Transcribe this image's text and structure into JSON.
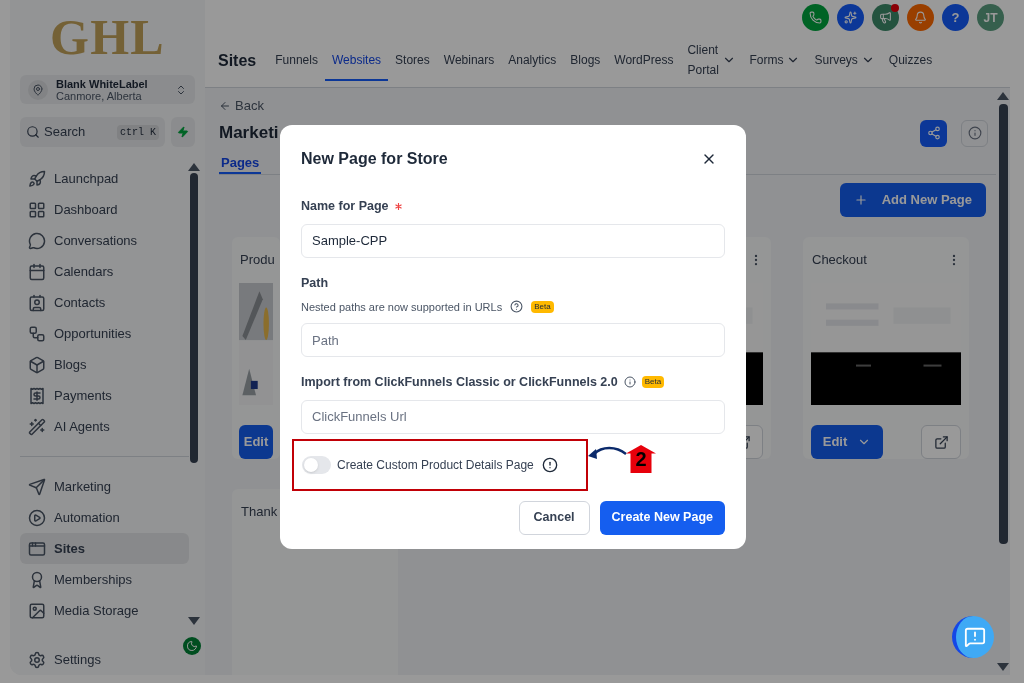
{
  "logo": "GHL",
  "account": {
    "name": "Blank WhiteLabel",
    "location": "Canmore, Alberta"
  },
  "search": {
    "placeholder": "Search",
    "shortcut": "ctrl K"
  },
  "sidebar": {
    "groups": [
      {
        "items": [
          {
            "label": "Launchpad",
            "selected": false
          },
          {
            "label": "Dashboard",
            "selected": false
          },
          {
            "label": "Conversations",
            "selected": false
          },
          {
            "label": "Calendars",
            "selected": false
          },
          {
            "label": "Contacts",
            "selected": false
          },
          {
            "label": "Opportunities",
            "selected": false
          },
          {
            "label": "Blogs",
            "selected": false
          },
          {
            "label": "Payments",
            "selected": false
          },
          {
            "label": "AI Agents",
            "selected": false
          }
        ]
      },
      {
        "items": [
          {
            "label": "Marketing",
            "selected": false
          },
          {
            "label": "Automation",
            "selected": false
          },
          {
            "label": "Sites",
            "selected": true
          },
          {
            "label": "Memberships",
            "selected": false
          },
          {
            "label": "Media Storage",
            "selected": false
          }
        ]
      }
    ],
    "settings": "Settings"
  },
  "header": {
    "title": "Sites",
    "tabs": [
      {
        "label": "Funnels",
        "selected": false,
        "menu": false
      },
      {
        "label": "Websites",
        "selected": true,
        "menu": false
      },
      {
        "label": "Stores",
        "selected": false,
        "menu": false
      },
      {
        "label": "Webinars",
        "selected": false,
        "menu": false
      },
      {
        "label": "Analytics",
        "selected": false,
        "menu": false
      },
      {
        "label": "Blogs",
        "selected": false,
        "menu": false
      },
      {
        "label": "WordPress",
        "selected": false,
        "menu": false
      },
      {
        "label": "Client Portal",
        "selected": false,
        "menu": true
      },
      {
        "label": "Forms",
        "selected": false,
        "menu": true
      },
      {
        "label": "Surveys",
        "selected": false,
        "menu": true
      },
      {
        "label": "Quizzes",
        "selected": false,
        "menu": false
      }
    ],
    "avatar": "JT",
    "help": "?"
  },
  "page": {
    "back": "Back",
    "title": "Marketi",
    "tabs": [
      {
        "label": "Pages",
        "selected": true
      }
    ],
    "add_button": "Add New Page",
    "cards": [
      {
        "title": "Produ",
        "edit": "Edit"
      },
      {
        "title": "Checkout",
        "edit": "Edit"
      },
      {
        "title": "Thank"
      }
    ]
  },
  "modal": {
    "title": "New Page for Store",
    "fields": [
      {
        "label": "Name for Page",
        "required": true,
        "value": "Sample-CPP"
      },
      {
        "label": "Path",
        "hint": "Nested paths are now supported in URLs",
        "badge": "Beta",
        "placeholder": "Path"
      },
      {
        "label": "Import from ClickFunnels Classic or ClickFunnels 2.0",
        "badge": "Beta",
        "placeholder": "ClickFunnels Url"
      }
    ],
    "toggle": {
      "label": "Create Custom Product Details Page",
      "on": false
    },
    "buttons": [
      {
        "label": "Cancel",
        "kind": "secondary"
      },
      {
        "label": "Create New Page",
        "kind": "primary"
      }
    ]
  },
  "annotation": {
    "step": "2"
  }
}
